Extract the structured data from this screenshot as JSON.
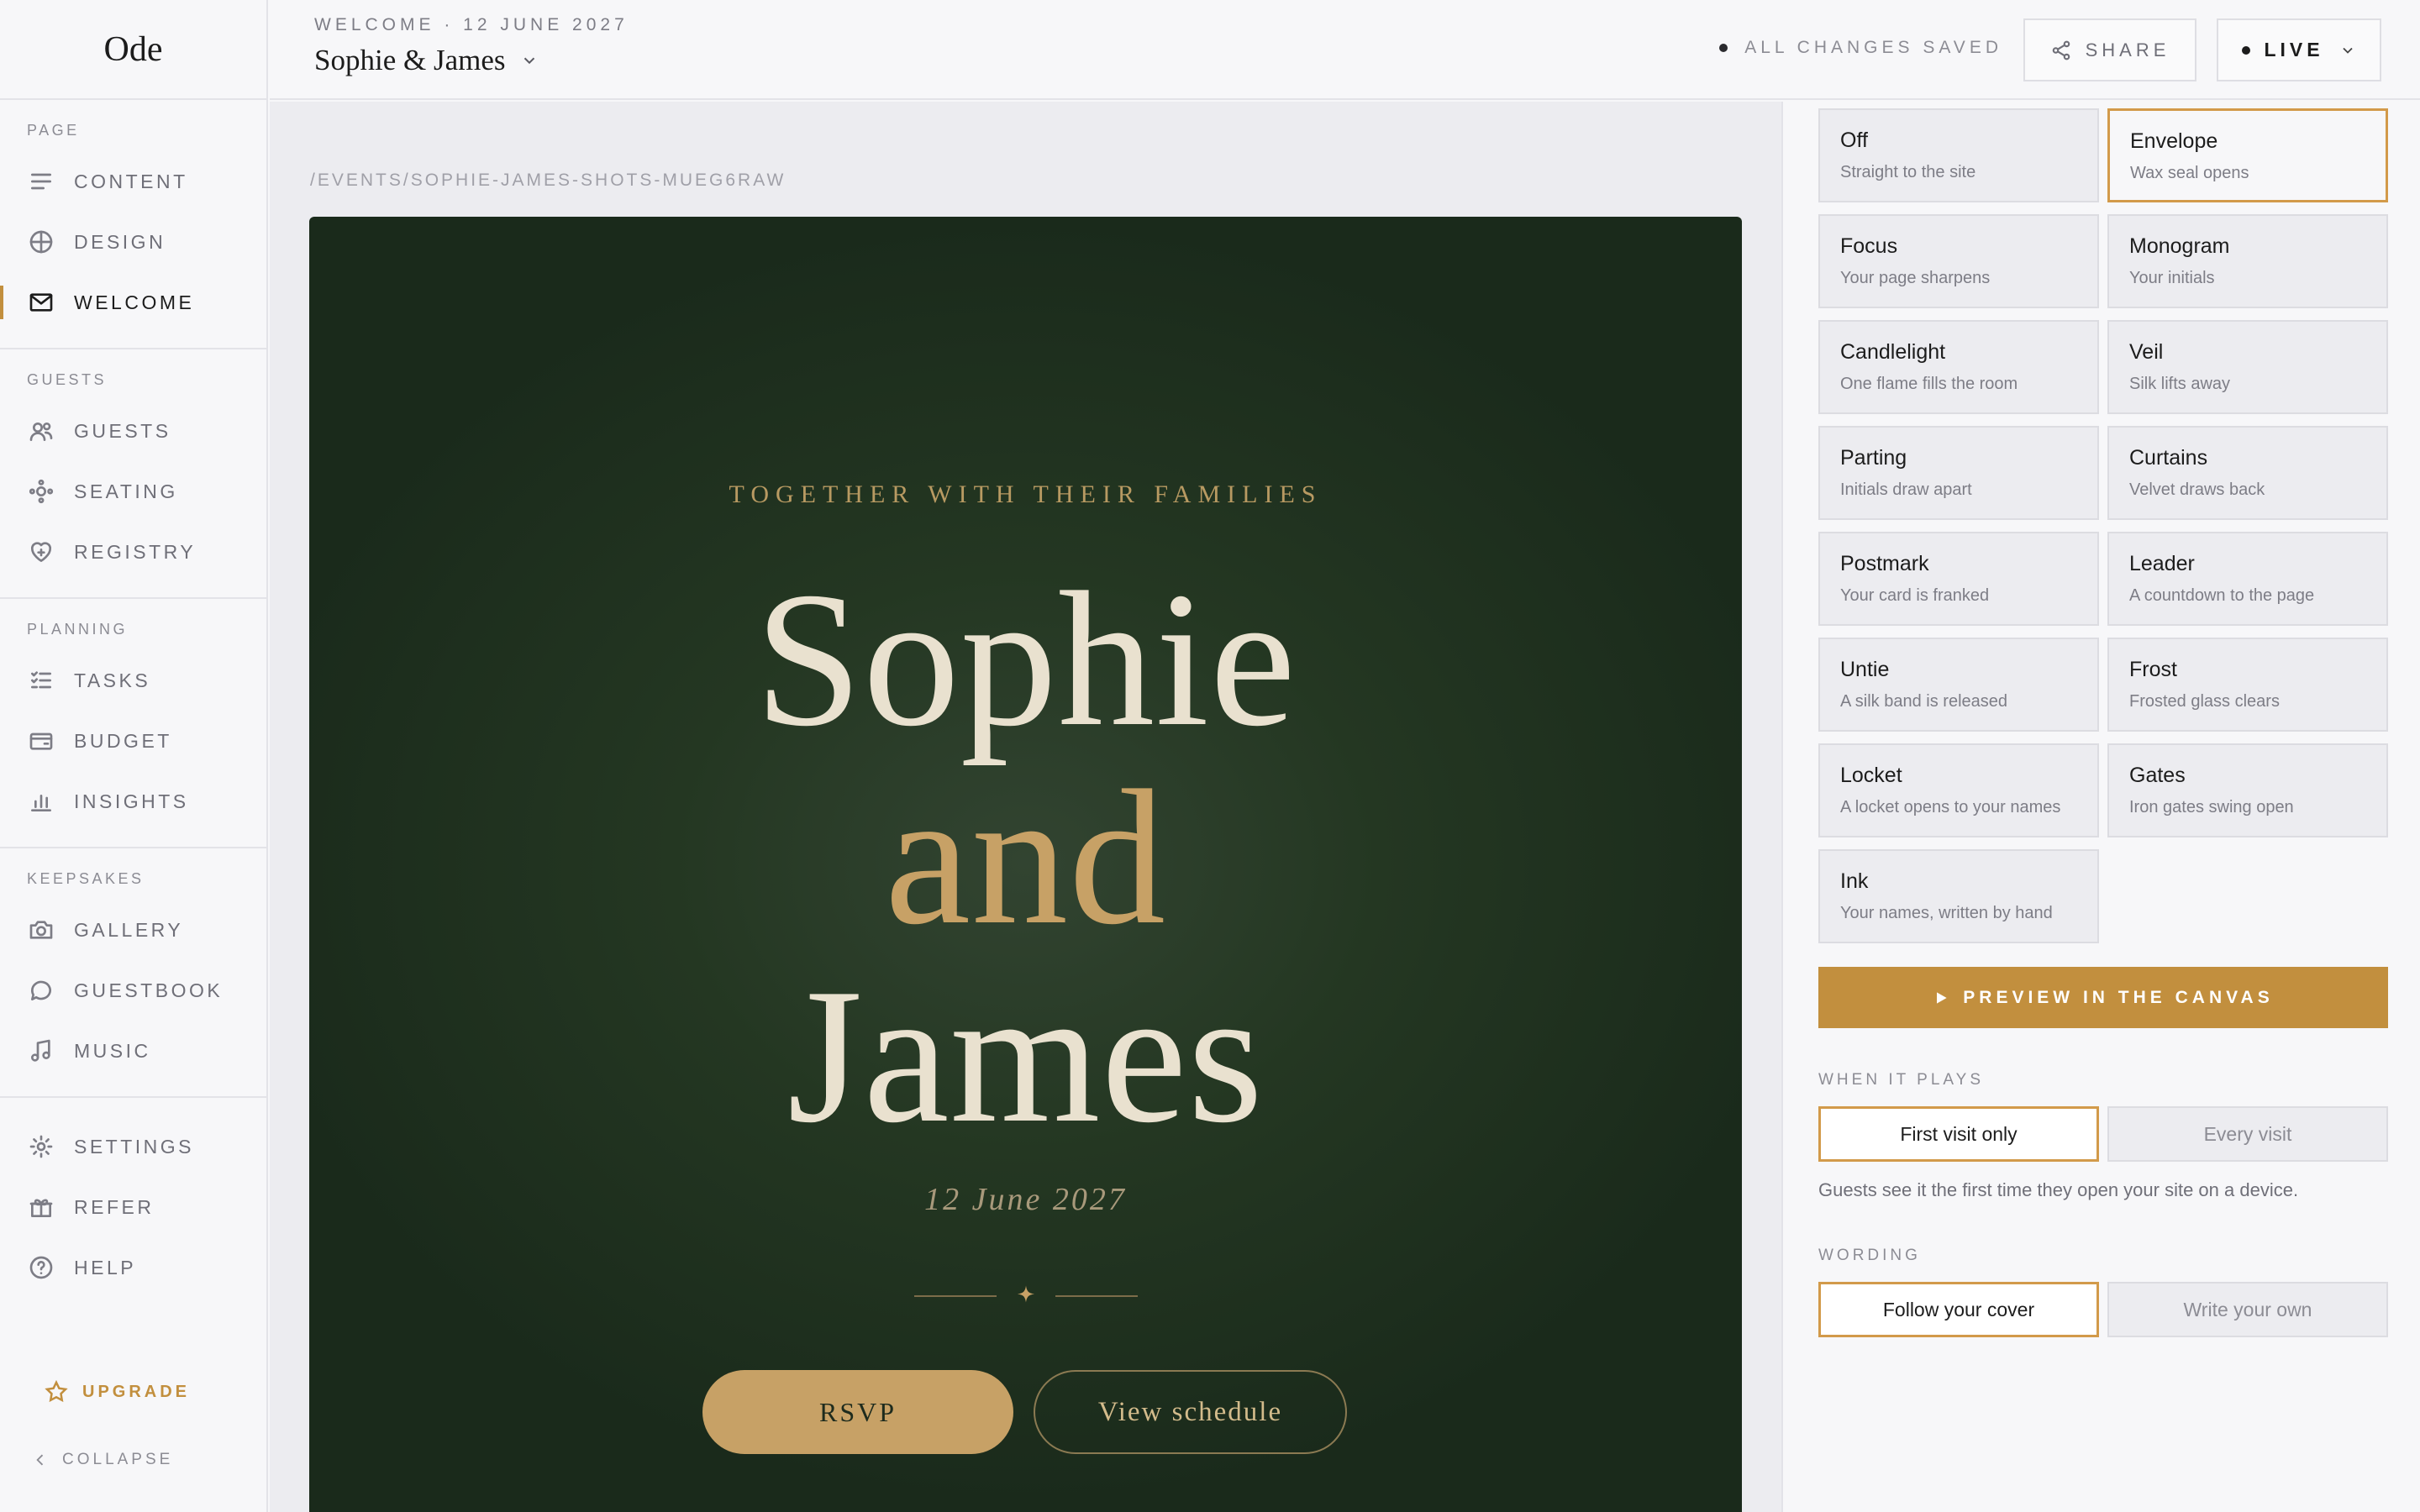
{
  "brand": "Ode",
  "sidebar": {
    "groups": [
      {
        "title": "PAGE",
        "items": [
          {
            "label": "CONTENT",
            "icon": "lines-icon"
          },
          {
            "label": "DESIGN",
            "icon": "globe-icon"
          },
          {
            "label": "WELCOME",
            "icon": "envelope-icon",
            "active": true
          }
        ]
      },
      {
        "title": "GUESTS",
        "items": [
          {
            "label": "GUESTS",
            "icon": "users-icon"
          },
          {
            "label": "SEATING",
            "icon": "seating-icon"
          },
          {
            "label": "REGISTRY",
            "icon": "heart-icon"
          }
        ]
      },
      {
        "title": "PLANNING",
        "items": [
          {
            "label": "TASKS",
            "icon": "checklist-icon"
          },
          {
            "label": "BUDGET",
            "icon": "wallet-icon"
          },
          {
            "label": "INSIGHTS",
            "icon": "bar-chart-icon"
          }
        ]
      },
      {
        "title": "KEEPSAKES",
        "items": [
          {
            "label": "GALLERY",
            "icon": "camera-icon"
          },
          {
            "label": "GUESTBOOK",
            "icon": "speech-bubble-icon"
          },
          {
            "label": "MUSIC",
            "icon": "music-note-icon"
          }
        ]
      },
      {
        "title": "",
        "items": [
          {
            "label": "SETTINGS",
            "icon": "gear-icon"
          },
          {
            "label": "REFER",
            "icon": "gift-icon"
          },
          {
            "label": "HELP",
            "icon": "question-icon"
          }
        ]
      }
    ],
    "upgrade_label": "UPGRADE",
    "collapse_label": "COLLAPSE"
  },
  "header": {
    "eyebrow": "WELCOME · 12 JUNE 2027",
    "event_title": "Sophie & James",
    "saved_status": "ALL CHANGES SAVED",
    "share_label": "SHARE",
    "live_label": "LIVE"
  },
  "canvas": {
    "path": "/EVENTS/SOPHIE-JAMES-SHOTS-MUEG6RAW",
    "eyebrow": "TOGETHER WITH THEIR FAMILIES",
    "name_one": "Sophie",
    "conjunction": "and",
    "name_two": "James",
    "date": "12 June 2027",
    "rsvp_label": "RSVP",
    "schedule_label": "View schedule"
  },
  "panel": {
    "styles": [
      {
        "title": "Off",
        "subtitle": "Straight to the site"
      },
      {
        "title": "Envelope",
        "subtitle": "Wax seal opens",
        "selected": true
      },
      {
        "title": "Focus",
        "subtitle": "Your page sharpens"
      },
      {
        "title": "Monogram",
        "subtitle": "Your initials"
      },
      {
        "title": "Candlelight",
        "subtitle": "One flame fills the room"
      },
      {
        "title": "Veil",
        "subtitle": "Silk lifts away"
      },
      {
        "title": "Parting",
        "subtitle": "Initials draw apart"
      },
      {
        "title": "Curtains",
        "subtitle": "Velvet draws back"
      },
      {
        "title": "Postmark",
        "subtitle": "Your card is franked"
      },
      {
        "title": "Leader",
        "subtitle": "A countdown to the page"
      },
      {
        "title": "Untie",
        "subtitle": "A silk band is released"
      },
      {
        "title": "Frost",
        "subtitle": "Frosted glass clears"
      },
      {
        "title": "Locket",
        "subtitle": "A locket opens to your names"
      },
      {
        "title": "Gates",
        "subtitle": "Iron gates swing open"
      },
      {
        "title": "Ink",
        "subtitle": "Your names, written by hand"
      }
    ],
    "preview_label": "PREVIEW IN THE CANVAS",
    "when_title": "WHEN IT PLAYS",
    "when_options": [
      "First visit only",
      "Every visit"
    ],
    "when_help": "Guests see it the first time they open your site on a device.",
    "wording_title": "WORDING",
    "wording_options": [
      "Follow your cover",
      "Write your own"
    ]
  },
  "colors": {
    "accent": "#c28f3e",
    "card_background": "#1f311f",
    "card_gold": "#c7a166",
    "card_cream": "#e9e1cf"
  }
}
